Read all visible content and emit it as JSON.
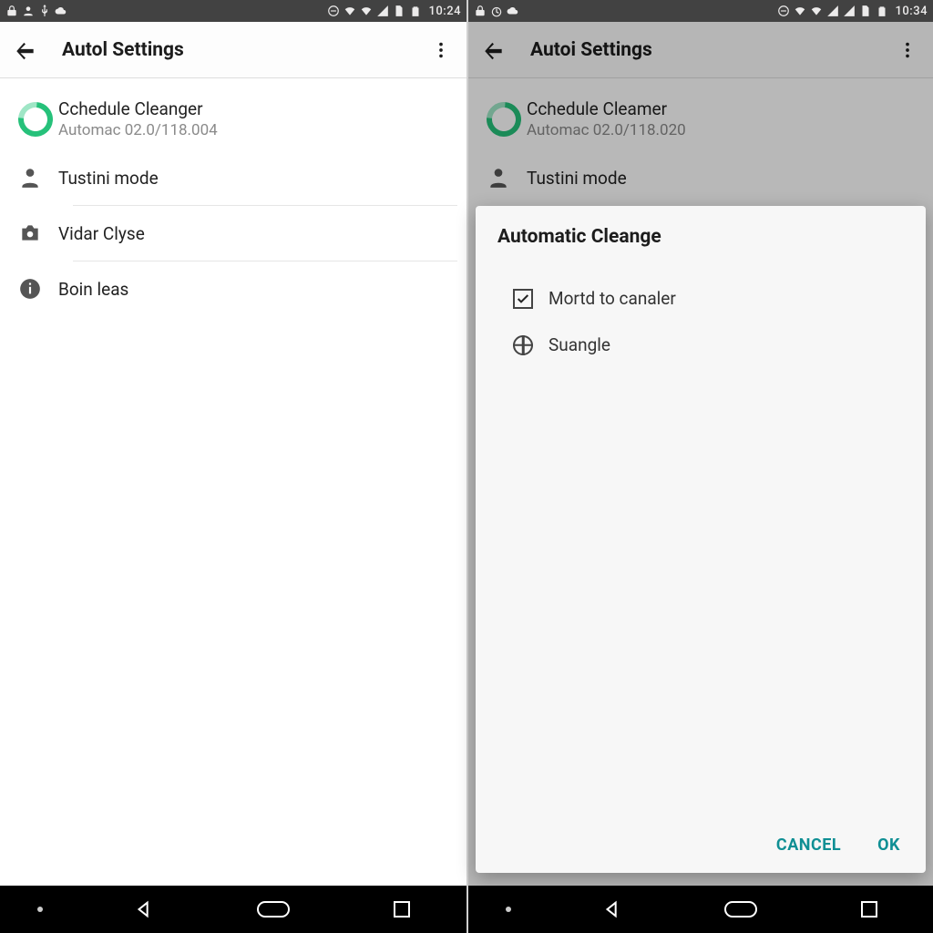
{
  "left": {
    "status_time": "10:24",
    "appbar_title": "Autol Settings",
    "item0": {
      "title": "Cchedule Cleanger",
      "subtitle": "Automac 02.0/118.004"
    },
    "item1": {
      "title": "Tustini mode"
    },
    "item2": {
      "title": "Vidar Clyse"
    },
    "item3": {
      "title": "Boin leas"
    }
  },
  "right": {
    "status_time": "10:34",
    "appbar_title": "Autoi Settings",
    "item0": {
      "title": "Cchedule Cleamer",
      "subtitle": "Automac 02.0/118.020"
    },
    "item1": {
      "title": "Tustini mode"
    },
    "dialog": {
      "title": "Automatic Cleange",
      "opt0": "Mortd to canaler",
      "opt1": "Suangle",
      "cancel": "CANCEL",
      "ok": "OK"
    }
  },
  "colors": {
    "accent": "#0f8f94",
    "ring": "#26c17a"
  }
}
